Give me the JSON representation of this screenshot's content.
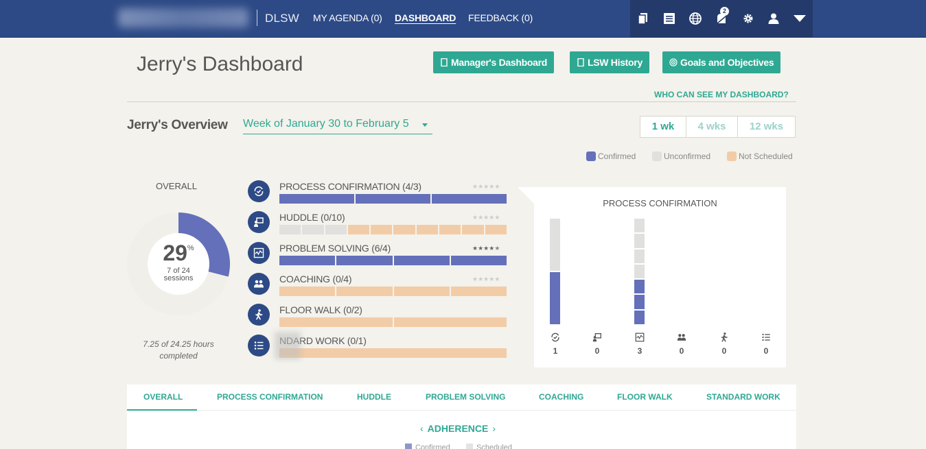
{
  "topbar": {
    "brand": "DLSW",
    "nav": [
      {
        "label": "MY AGENDA (0)"
      },
      {
        "label": "DASHBOARD"
      },
      {
        "label": "FEEDBACK (0)"
      }
    ],
    "icons": [
      "documents-icon",
      "list-icon",
      "globe-icon",
      "notifications-icon",
      "gear-icon",
      "user-icon",
      "dropdown-caret-icon"
    ],
    "notification_count": "2"
  },
  "header": {
    "title": "Jerry's Dashboard",
    "buttons": {
      "managers_dashboard": "Manager's Dashboard",
      "lsw_history": "LSW History",
      "goals": "Goals and Objectives"
    },
    "who_can_see": "WHO CAN SEE MY DASHBOARD?"
  },
  "overview": {
    "title": "Jerry's Overview",
    "week": "Week of January 30 to February 5",
    "ranges": [
      "1 wk",
      "4 wks",
      "12 wks"
    ],
    "selected_range": "1 wk",
    "legend": {
      "confirmed": "Confirmed",
      "unconfirmed": "Unconfirmed",
      "not_scheduled": "Not Scheduled"
    }
  },
  "colors": {
    "confirmed": "#6470b9",
    "unconfirmed": "#e0e0de",
    "not_scheduled": "#f2cca6",
    "accent": "#2fa893",
    "nav": "#2d4a86"
  },
  "overall": {
    "label": "OVERALL",
    "percent": "29",
    "percent_sign": "%",
    "percent_value": 0.29,
    "sessions_line1": "7 of 24",
    "sessions_line2": "sessions",
    "hours_line1": "7.25 of 24.25 hours",
    "hours_line2": "completed"
  },
  "activities": [
    {
      "label": "PROCESS CONFIRMATION (4/3)",
      "icon": "process-confirmation-icon",
      "stars": 0,
      "segments": [
        "confirmed",
        "confirmed",
        "confirmed"
      ]
    },
    {
      "label": "HUDDLE (0/10)",
      "icon": "huddle-icon",
      "stars": 0,
      "segments": [
        "unconfirmed",
        "unconfirmed",
        "unconfirmed",
        "not_scheduled",
        "not_scheduled",
        "not_scheduled",
        "not_scheduled",
        "not_scheduled",
        "not_scheduled",
        "not_scheduled"
      ]
    },
    {
      "label": "PROBLEM SOLVING (6/4)",
      "icon": "problem-solving-icon",
      "stars": 4.5,
      "segments": [
        "confirmed",
        "confirmed",
        "confirmed",
        "confirmed"
      ]
    },
    {
      "label": "COACHING (0/4)",
      "icon": "coaching-icon",
      "stars": 0,
      "segments": [
        "not_scheduled",
        "not_scheduled",
        "not_scheduled",
        "not_scheduled"
      ]
    },
    {
      "label": "FLOOR WALK (0/2)",
      "icon": "floor-walk-icon",
      "stars": 0,
      "segments": [
        "not_scheduled",
        "not_scheduled"
      ]
    },
    {
      "label": "NDARD WORK (0/1)",
      "icon": "standard-work-icon",
      "stars": 0,
      "segments": [
        "not_scheduled"
      ]
    }
  ],
  "process_confirmation": {
    "title": "PROCESS CONFIRMATION",
    "columns": [
      {
        "icon": "process-confirmation-icon",
        "count": "1",
        "cells": [
          {
            "state": "confirmed",
            "weight": 1
          },
          {
            "state": "unconfirmed",
            "weight": 1
          }
        ]
      },
      {
        "icon": "huddle-icon",
        "count": "0",
        "cells": []
      },
      {
        "icon": "problem-solving-icon",
        "count": "3",
        "cells": [
          {
            "state": "confirmed",
            "weight": 1
          },
          {
            "state": "confirmed",
            "weight": 1
          },
          {
            "state": "confirmed",
            "weight": 1
          },
          {
            "state": "unconfirmed",
            "weight": 1
          },
          {
            "state": "unconfirmed",
            "weight": 1
          },
          {
            "state": "unconfirmed",
            "weight": 1
          },
          {
            "state": "unconfirmed",
            "weight": 1
          }
        ]
      },
      {
        "icon": "coaching-icon",
        "count": "0",
        "cells": []
      },
      {
        "icon": "floor-walk-icon",
        "count": "0",
        "cells": []
      },
      {
        "icon": "standard-work-icon",
        "count": "0",
        "cells": []
      }
    ]
  },
  "tabs": [
    "OVERALL",
    "PROCESS CONFIRMATION",
    "HUDDLE",
    "PROBLEM SOLVING",
    "COACHING",
    "FLOOR WALK",
    "STANDARD WORK"
  ],
  "adherence": {
    "label": "ADHERENCE",
    "legend_confirmed": "Confirmed",
    "legend_scheduled": "Scheduled"
  }
}
